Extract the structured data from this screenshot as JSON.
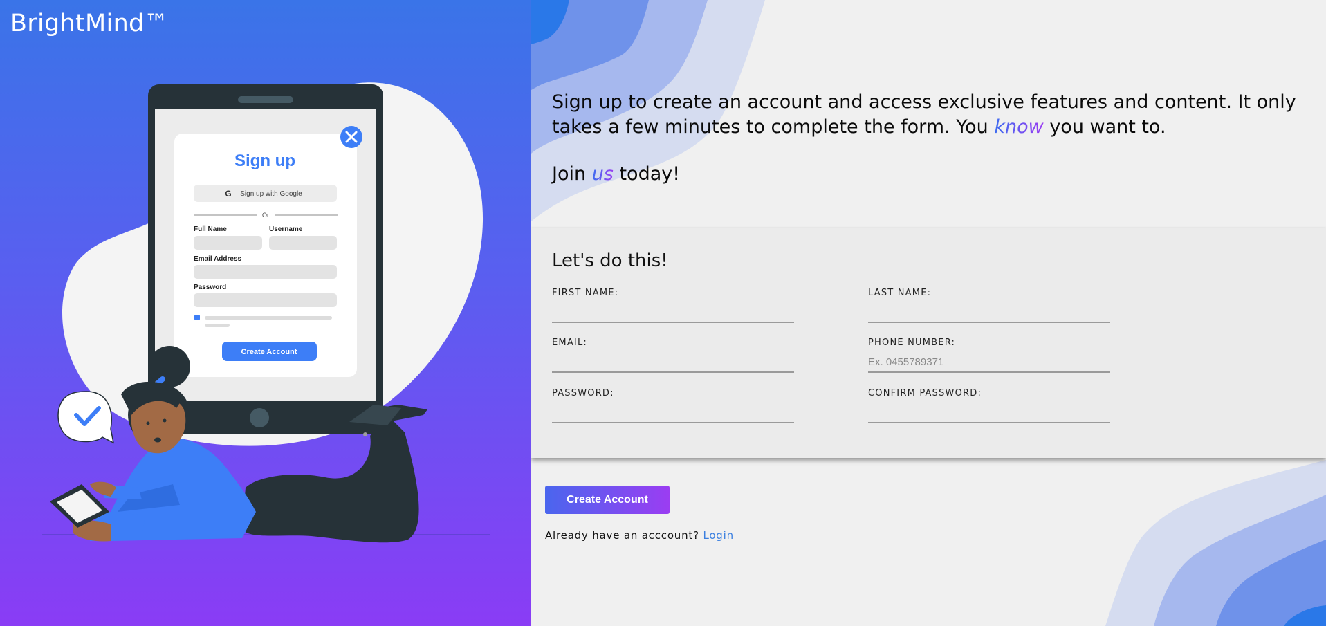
{
  "brand": {
    "name": "BrightMind™"
  },
  "mock_form": {
    "title": "Sign up",
    "google_label": "Sign up with Google",
    "or_label": "Or",
    "full_name_label": "Full Name",
    "username_label": "Username",
    "email_label": "Email Address",
    "password_label": "Password",
    "create_label": "Create Account"
  },
  "intro": {
    "part1": "Sign up to create an account and access exclusive features and content. It only takes a few minutes to complete the form. You ",
    "highlight": "know",
    "part2": " you want to.",
    "join_prefix": "Join ",
    "join_highlight": "us",
    "join_suffix": " today!"
  },
  "form": {
    "title": "Let's do this!",
    "fields": {
      "first_name": {
        "label": "FIRST NAME:",
        "value": "",
        "placeholder": ""
      },
      "last_name": {
        "label": "LAST NAME:",
        "value": "",
        "placeholder": ""
      },
      "email": {
        "label": "EMAIL:",
        "value": "",
        "placeholder": ""
      },
      "phone": {
        "label": "PHONE NUMBER:",
        "value": "",
        "placeholder": "Ex. 0455789371"
      },
      "password": {
        "label": "PASSWORD:",
        "value": "",
        "placeholder": ""
      },
      "confirm_password": {
        "label": "CONFIRM PASSWORD:",
        "value": "",
        "placeholder": ""
      }
    },
    "submit_label": "Create Account",
    "login_prompt": "Already have an acccount?",
    "login_link": "Login"
  },
  "colors": {
    "gradient_start": "#3a74e8",
    "gradient_end": "#8a3cf5",
    "accent_blue": "#3d7ef7",
    "link": "#3a7fe0"
  },
  "icons": [
    "close-icon",
    "google-icon",
    "check-icon"
  ]
}
